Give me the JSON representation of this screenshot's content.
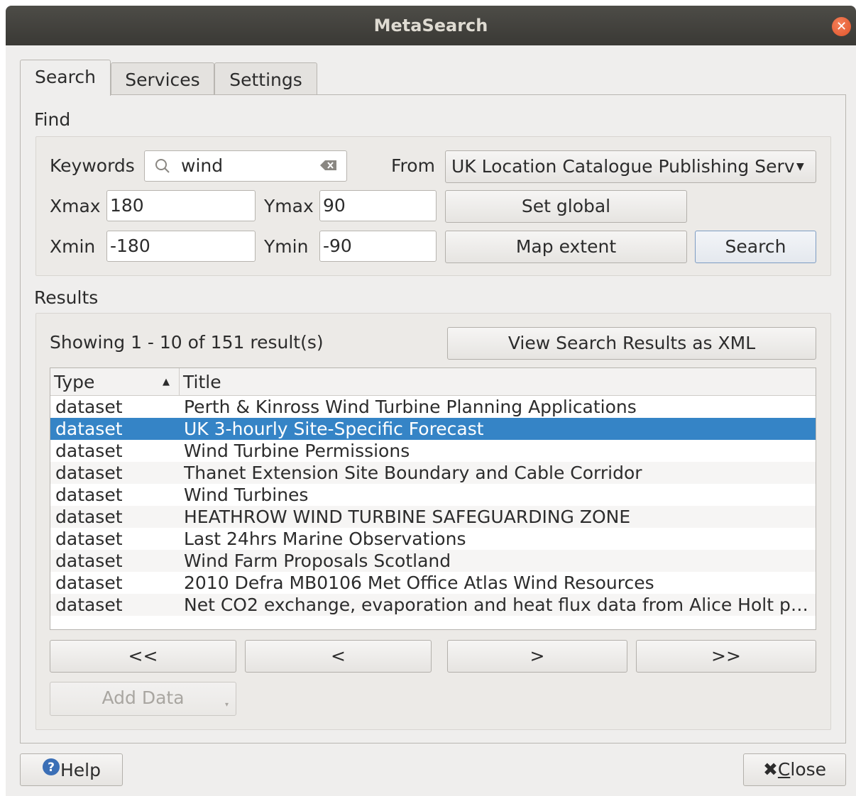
{
  "window": {
    "title": "MetaSearch"
  },
  "tabs": [
    {
      "label": "Search",
      "active": true
    },
    {
      "label": "Services",
      "active": false
    },
    {
      "label": "Settings",
      "active": false
    }
  ],
  "find": {
    "section_label": "Find",
    "keywords_label": "Keywords",
    "keywords_value": "wind",
    "from_label": "From",
    "from_value": "UK Location Catalogue Publishing Serv",
    "xmax_label": "Xmax",
    "xmax_value": "180",
    "ymax_label": "Ymax",
    "ymax_value": "90",
    "xmin_label": "Xmin",
    "xmin_value": "-180",
    "ymin_label": "Ymin",
    "ymin_value": "-90",
    "set_global_label": "Set global",
    "map_extent_label": "Map extent",
    "search_label": "Search"
  },
  "results": {
    "section_label": "Results",
    "showing_text": "Showing 1 - 10 of 151 result(s)",
    "view_xml_label": "View Search Results as XML",
    "columns": [
      "Type",
      "Title"
    ],
    "sort_indicator": "▲",
    "rows": [
      {
        "type": "dataset",
        "title": "Perth & Kinross Wind Turbine Planning Applications"
      },
      {
        "type": "dataset",
        "title": "UK 3-hourly Site-Specific Forecast"
      },
      {
        "type": "dataset",
        "title": "Wind Turbine Permissions"
      },
      {
        "type": "dataset",
        "title": "Thanet Extension Site Boundary and Cable Corridor"
      },
      {
        "type": "dataset",
        "title": "Wind Turbines"
      },
      {
        "type": "dataset",
        "title": "HEATHROW WIND TURBINE SAFEGUARDING ZONE"
      },
      {
        "type": "dataset",
        "title": "Last 24hrs Marine Observations"
      },
      {
        "type": "dataset",
        "title": "Wind Farm Proposals Scotland"
      },
      {
        "type": "dataset",
        "title": "2010 Defra MB0106 Met Office Atlas Wind Resources"
      },
      {
        "type": "dataset",
        "title": "Net CO2 exchange, evaporation and heat flux data from Alice Holt pl…"
      }
    ],
    "selected_row": 1,
    "nav": {
      "first": "<<",
      "prev": "<",
      "next": ">",
      "last": ">>"
    },
    "add_data_label": "Add Data"
  },
  "footer": {
    "help_label": "Help",
    "close_label": "Close",
    "close_mnemonic": "C",
    "close_rest": "lose"
  },
  "colors": {
    "selection": "#3584c6",
    "titlebar": "#3c3b37",
    "close_button": "#e0542a"
  }
}
